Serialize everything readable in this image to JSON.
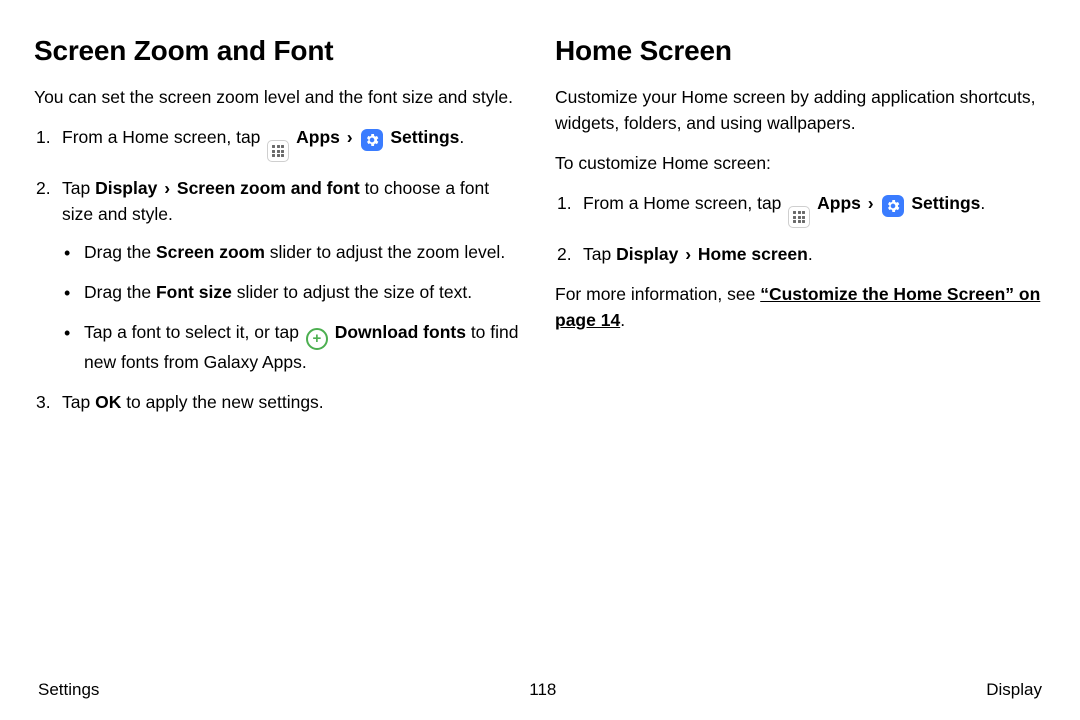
{
  "left": {
    "heading": "Screen Zoom and Font",
    "intro": "You can set the screen zoom level and the font size and style.",
    "step1_pre": "From a Home screen, tap ",
    "apps_label": "Apps",
    "sep": "›",
    "settings_label": "Settings",
    "step1_post": ".",
    "step2a": "Tap ",
    "step2b": "Display",
    "step2c": "Screen zoom and font",
    "step2d": " to choose a font size and style.",
    "b1a": "Drag the ",
    "b1b": "Screen zoom",
    "b1c": " slider to adjust the zoom level.",
    "b2a": "Drag the ",
    "b2b": "Font size",
    "b2c": " slider to adjust the size of text.",
    "b3a": "Tap a font to select it, or tap ",
    "b3b": "Download fonts",
    "b3c": " to find new fonts from Galaxy Apps.",
    "step3a": "Tap ",
    "step3b": "OK",
    "step3c": " to apply the new settings."
  },
  "right": {
    "heading": "Home Screen",
    "intro": "Customize your Home screen by adding application shortcuts, widgets, folders, and using wallpapers.",
    "lead": "To customize Home screen:",
    "step1_pre": "From a Home screen, tap ",
    "apps_label": "Apps",
    "sep": "›",
    "settings_label": "Settings",
    "step1_post": ".",
    "step2a": "Tap ",
    "step2b": "Display",
    "step2c": "Home screen",
    "step2d": ".",
    "more_a": "For more information, see ",
    "more_b": "“Customize the Home Screen” on page 14",
    "more_c": "."
  },
  "footer": {
    "left": "Settings",
    "center": "118",
    "right": "Display"
  }
}
